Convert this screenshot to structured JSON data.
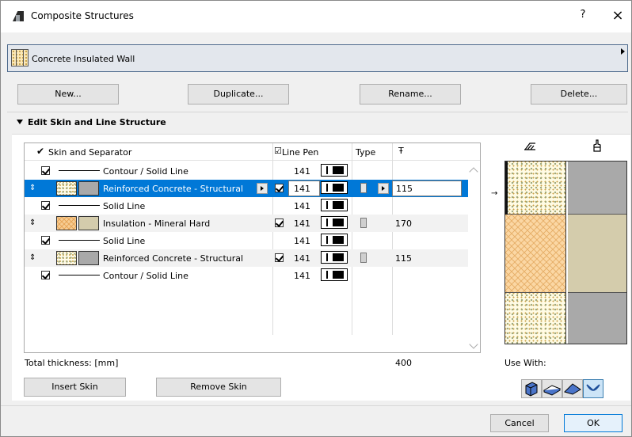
{
  "window": {
    "title": "Composite Structures",
    "help": "?",
    "close": "×"
  },
  "selector": {
    "name": "Concrete Insulated Wall"
  },
  "buttons": {
    "new": "New...",
    "duplicate": "Duplicate...",
    "rename": "Rename...",
    "delete": "Delete..."
  },
  "section": {
    "title": "Edit Skin and Line Structure"
  },
  "table": {
    "headers": {
      "skin": "Skin and Separator",
      "line_pen": "Line Pen",
      "type": "Type",
      "thickness_icon": "Ŧ"
    },
    "rows": [
      {
        "kind": "line",
        "label": "Contour / Solid Line",
        "pen": "141",
        "checked": true
      },
      {
        "kind": "skin",
        "label": "Reinforced Concrete - Structural",
        "pen": "141",
        "thickness": "115",
        "selected": true,
        "fill": "concrete",
        "color": "#a9a9a9"
      },
      {
        "kind": "line",
        "label": "Solid Line",
        "pen": "141",
        "checked": true
      },
      {
        "kind": "skin",
        "label": "Insulation - Mineral Hard",
        "pen": "141",
        "thickness": "170",
        "fill": "insulation",
        "color": "#d4ccac"
      },
      {
        "kind": "line",
        "label": "Solid Line",
        "pen": "141",
        "checked": true
      },
      {
        "kind": "skin",
        "label": "Reinforced Concrete - Structural",
        "pen": "141",
        "thickness": "115",
        "fill": "concrete",
        "color": "#a9a9a9"
      },
      {
        "kind": "line",
        "label": "Contour / Solid Line",
        "pen": "141",
        "checked": true
      }
    ]
  },
  "total": {
    "label": "Total thickness: [mm]",
    "value": "400"
  },
  "skin_buttons": {
    "insert": "Insert Skin",
    "remove": "Remove Skin"
  },
  "use_with": {
    "label": "Use With:"
  },
  "footer": {
    "cancel": "Cancel",
    "ok": "OK"
  },
  "colors": {
    "selection": "#0078d7",
    "selector_bg": "#e3e7ed",
    "concrete": "#a9a9a9",
    "insulation": "#d4ccac"
  }
}
